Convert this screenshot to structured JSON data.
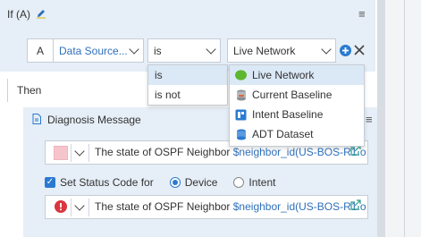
{
  "if_section": {
    "title": "If (A)"
  },
  "condition": {
    "letter": "A",
    "source_select": "Data Source...",
    "operator_select": "is",
    "value_select": "Live Network"
  },
  "operator_dropdown": {
    "options": [
      "is",
      "is not"
    ]
  },
  "source_dropdown": {
    "options": [
      {
        "label": "Live Network",
        "badge": "Live"
      },
      {
        "label": "Current Baseline"
      },
      {
        "label": "Intent Baseline"
      },
      {
        "label": "ADT Dataset"
      }
    ]
  },
  "then_section": {
    "title": "Then"
  },
  "diagnosis": {
    "title": "Diagnosis Message",
    "message1": {
      "text": "The state of OSPF Neighbor ",
      "variable": "$neighbor_id(US-BOS-R1.o"
    },
    "status": {
      "checkbox_label": "Set Status Code for",
      "radio_device": "Device",
      "radio_intent": "Intent"
    },
    "message2": {
      "text": "The state of OSPF Neighbor ",
      "variable": "$neighbor_id(US-BOS-R1.o"
    }
  },
  "colors": {
    "accent": "#2a7ad1",
    "panel": "#e6eef7",
    "error": "#d9363e",
    "swatch": "#f6c5cc"
  }
}
